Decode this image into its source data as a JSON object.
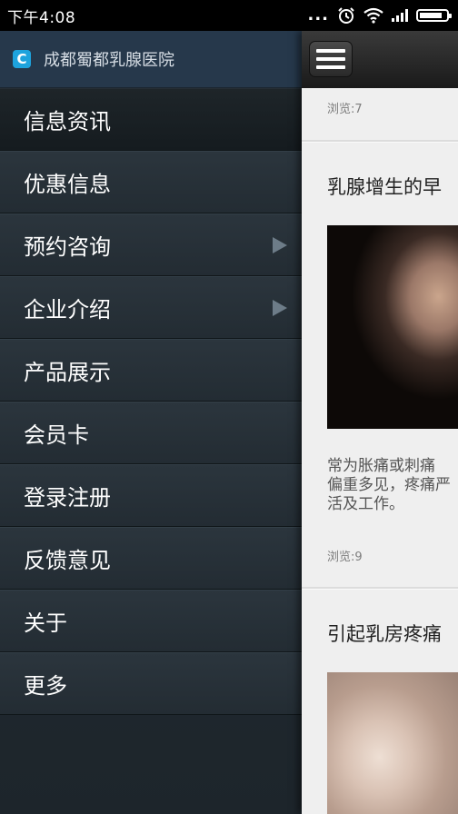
{
  "status": {
    "time": "下午4:08",
    "dots": "...",
    "battery_level": 0.85
  },
  "drawer": {
    "app_name": "成都蜀都乳腺医院",
    "logo_letter": "C",
    "items": [
      {
        "label": "信息资讯",
        "arrow": false
      },
      {
        "label": "优惠信息",
        "arrow": false
      },
      {
        "label": "预约咨询",
        "arrow": true
      },
      {
        "label": "企业介绍",
        "arrow": true
      },
      {
        "label": "产品展示",
        "arrow": false
      },
      {
        "label": "会员卡",
        "arrow": false
      },
      {
        "label": "登录注册",
        "arrow": false
      },
      {
        "label": "反馈意见",
        "arrow": false
      },
      {
        "label": "关于",
        "arrow": false
      },
      {
        "label": "更多",
        "arrow": false
      }
    ]
  },
  "content": {
    "views_top": "浏览:7",
    "article1": {
      "title": "乳腺增生的早",
      "excerpt": "常为胀痛或刺痛\n偏重多见，疼痛严\n活及工作。",
      "views": "浏览:9"
    },
    "article2": {
      "title": "引起乳房疼痛"
    }
  }
}
